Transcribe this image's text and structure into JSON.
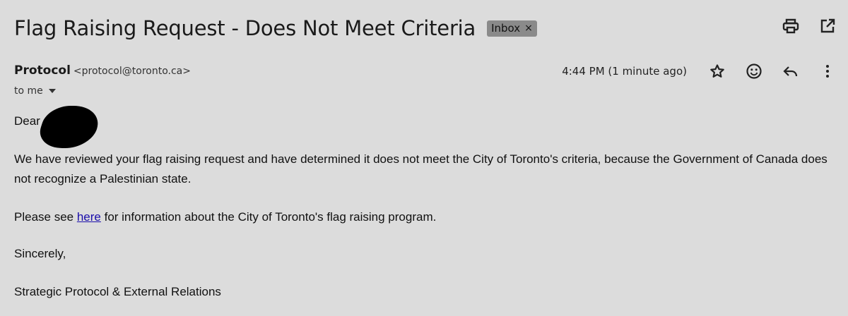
{
  "email": {
    "subject": "Flag Raising Request - Does Not Meet Criteria",
    "label": "Inbox",
    "label_remove": "×",
    "sender_name": "Protocol",
    "sender_email": "<protocol@toronto.ca>",
    "recipient": "to me",
    "timestamp": "4:44 PM (1 minute ago)",
    "greeting": "Dear",
    "para1": "We have reviewed your flag raising request and have determined it does not meet the City of Toronto's criteria, because the Government of Canada does not recognize a Palestinian state.",
    "para2_before": "Please see ",
    "para2_link": "here",
    "para2_after": " for information about the City of Toronto's flag raising program.",
    "closing": "Sincerely,",
    "signature": "Strategic Protocol & External Relations"
  },
  "icons": {
    "top": [
      "print-icon",
      "open-in-new-window-icon"
    ],
    "message": [
      "star-icon",
      "emoji-icon",
      "reply-icon",
      "more-vert-icon"
    ]
  }
}
